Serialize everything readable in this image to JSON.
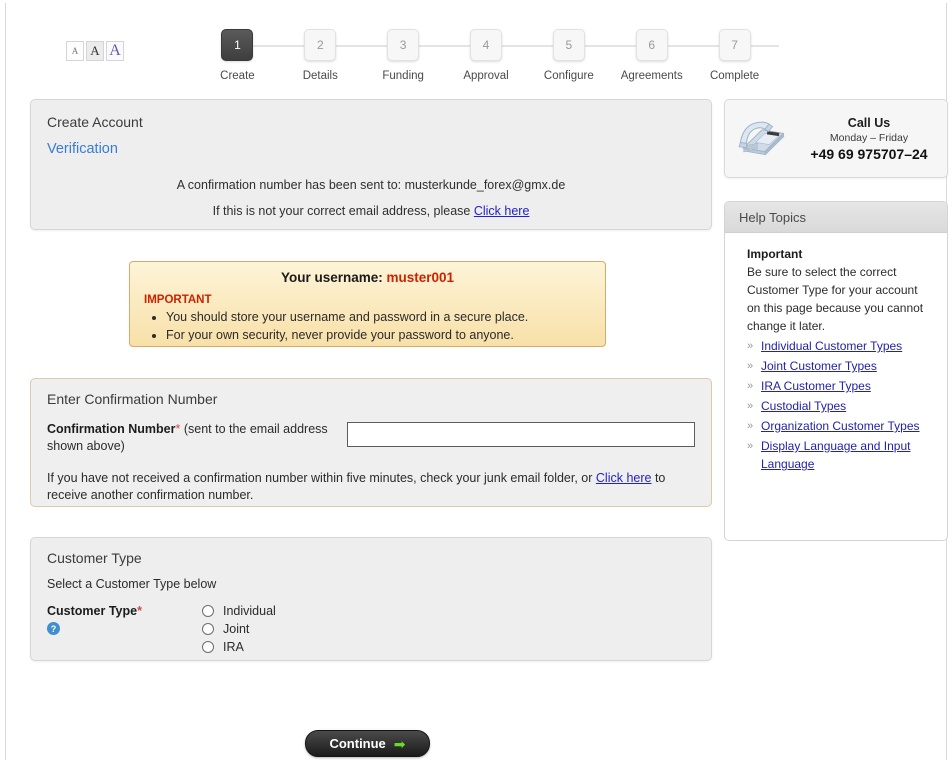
{
  "font_size_widget": {
    "options": [
      {
        "label": "A",
        "name": "font-size-small"
      },
      {
        "label": "A",
        "name": "font-size-medium"
      },
      {
        "label": "A",
        "name": "font-size-large"
      }
    ]
  },
  "steps": [
    {
      "number": "1",
      "label": "Create",
      "active": true
    },
    {
      "number": "2",
      "label": "Details",
      "active": false
    },
    {
      "number": "3",
      "label": "Funding",
      "active": false
    },
    {
      "number": "4",
      "label": "Approval",
      "active": false
    },
    {
      "number": "5",
      "label": "Configure",
      "active": false
    },
    {
      "number": "6",
      "label": "Agreements",
      "active": false
    },
    {
      "number": "7",
      "label": "Complete",
      "active": false
    }
  ],
  "verification": {
    "title": "Create Account",
    "subtitle": "Verification",
    "sent_prefix": "A confirmation number has been sent to: ",
    "email": "musterkunde_forex@gmx.de",
    "wrong_email_text": "If this is not your correct email address, please ",
    "wrong_email_link": "Click here"
  },
  "username_notice": {
    "heading_label": "Your username: ",
    "username": "muster001",
    "important_label": "IMPORTANT",
    "bullets": [
      "You should store your username and password in a secure place.",
      "For your own security, never provide your password to anyone."
    ]
  },
  "confirmation": {
    "title": "Enter Confirmation Number",
    "field_label_bold": "Confirmation Number",
    "required_star": "*",
    "field_label_rest": " (sent to the email address shown above)",
    "input_value": "",
    "input_placeholder": "",
    "note_before": "If you have not received a confirmation number within five minutes, check your junk email folder, or ",
    "note_link": "Click here",
    "note_after": " to receive another confirmation number."
  },
  "customer_type": {
    "title": "Customer Type",
    "subtitle": "Select a Customer Type below",
    "field_label": "Customer Type",
    "required_star": "*",
    "help_icon_glyph": "?",
    "options": [
      {
        "label": "Individual",
        "checked": false
      },
      {
        "label": "Joint",
        "checked": false
      },
      {
        "label": "IRA",
        "checked": false
      }
    ]
  },
  "call_us": {
    "icon": "telephone-icon",
    "title": "Call Us",
    "hours": "Monday – Friday",
    "number": "+49 69 975707–24"
  },
  "help_topics": {
    "header": "Help Topics",
    "important_label": "Important",
    "paragraph": "Be sure to select the correct Customer Type for your account on this page because you cannot change it later.",
    "chevron": "»",
    "links": [
      "Individual Customer Types",
      "Joint Customer Types",
      "IRA Customer Types",
      "Custodial Types",
      "Organization Customer Types",
      "Display Language and Input Language"
    ]
  },
  "continue_button": {
    "label": "Continue",
    "arrow_glyph": "➡"
  },
  "colors": {
    "panel_background": "#eeeeee",
    "panel_border": "#d6d6d6",
    "link_blue": "#2222cc",
    "subtitle_blue": "#3a7bd5",
    "alert_red": "#cc2200",
    "notice_border": "#d8a96b",
    "notice_gradient_top": "#fdf4d8",
    "notice_gradient_bottom": "#f8e0a8",
    "confirmation_border": "#e0c8a8",
    "step_active_background": "#4a4a4a",
    "continue_arrow_green": "#66dd22",
    "help_icon_blue": "#3f8fcf"
  }
}
